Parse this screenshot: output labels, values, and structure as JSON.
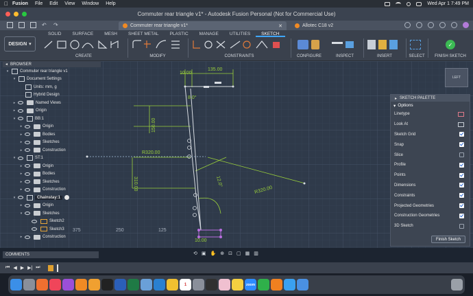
{
  "menubar": {
    "app": "Fusion",
    "items": [
      "File",
      "Edit",
      "View",
      "Window",
      "Help"
    ],
    "clock": "Wed Apr 1  7:49 PM"
  },
  "window": {
    "title": "Commuter rear triangle v1* - Autodesk Fusion Personal (Not for Commercial Use)"
  },
  "tabs": [
    {
      "label": "Commuter rear triangle v1*"
    },
    {
      "label": "Allotec C18 v2"
    }
  ],
  "toolbar": {
    "workspace": "DESIGN",
    "workspace_tabs": [
      "SOLID",
      "SURFACE",
      "MESH",
      "SHEET METAL",
      "PLASTIC",
      "MANAGE",
      "UTILITIES",
      "SKETCH"
    ],
    "groups": [
      "CREATE",
      "MODIFY",
      "CONSTRAINTS",
      "CONFIGURE",
      "INSPECT",
      "INSERT",
      "SELECT",
      "FINISH SKETCH"
    ]
  },
  "browser": {
    "title": "BROWSER",
    "rows": [
      {
        "label": "Commuter rear triangle v1",
        "indent": 0,
        "icon": "doc-icon",
        "arrow": "▾"
      },
      {
        "label": "Document Settings",
        "indent": 1,
        "icon": "gear-icon",
        "arrow": "▾"
      },
      {
        "label": "Units: mm, g",
        "indent": 2,
        "icon": "units-icon",
        "arrow": ""
      },
      {
        "label": "Hybrid Design",
        "indent": 2,
        "icon": "hybrid-icon",
        "arrow": ""
      },
      {
        "label": "Named Views",
        "indent": 1,
        "icon": "folder-icon",
        "arrow": "▸"
      },
      {
        "label": "Origin",
        "indent": 1,
        "icon": "folder-icon",
        "arrow": "▸"
      },
      {
        "label": "BB:1",
        "indent": 1,
        "icon": "component-icon",
        "arrow": "▾"
      },
      {
        "label": "Origin",
        "indent": 2,
        "icon": "folder-icon",
        "arrow": "▸"
      },
      {
        "label": "Bodies",
        "indent": 2,
        "icon": "folder-icon",
        "arrow": "▸"
      },
      {
        "label": "Sketches",
        "indent": 2,
        "icon": "folder-icon",
        "arrow": "▸"
      },
      {
        "label": "Construction",
        "indent": 2,
        "icon": "folder-icon",
        "arrow": "▸"
      },
      {
        "label": "ST:1",
        "indent": 1,
        "icon": "component-icon",
        "arrow": "▾"
      },
      {
        "label": "Origin",
        "indent": 2,
        "icon": "folder-icon",
        "arrow": "▸"
      },
      {
        "label": "Bodies",
        "indent": 2,
        "icon": "folder-icon",
        "arrow": "▸"
      },
      {
        "label": "Sketches",
        "indent": 2,
        "icon": "folder-icon",
        "arrow": "▸"
      },
      {
        "label": "Construction",
        "indent": 2,
        "icon": "folder-icon",
        "arrow": "▸"
      },
      {
        "label": "Chainstay:1",
        "indent": 1,
        "icon": "component-icon",
        "arrow": "▾",
        "active": true
      },
      {
        "label": "Origin",
        "indent": 2,
        "icon": "folder-icon",
        "arrow": "▸"
      },
      {
        "label": "Sketches",
        "indent": 2,
        "icon": "folder-icon",
        "arrow": "▾"
      },
      {
        "label": "Sketch2",
        "indent": 3,
        "icon": "sketch-icon",
        "arrow": ""
      },
      {
        "label": "Sketch3",
        "indent": 3,
        "icon": "sketch-icon",
        "arrow": ""
      },
      {
        "label": "Construction",
        "indent": 2,
        "icon": "folder-icon",
        "arrow": "▸"
      }
    ]
  },
  "palette": {
    "title": "SKETCH PALETTE",
    "section": "Options",
    "rows": [
      {
        "label": "Linetype",
        "control": "linetype-icon"
      },
      {
        "label": "Look At",
        "control": "lookat-icon"
      },
      {
        "label": "Sketch Grid",
        "checked": true
      },
      {
        "label": "Snap",
        "checked": true
      },
      {
        "label": "Slice",
        "checked": false
      },
      {
        "label": "Profile",
        "checked": true
      },
      {
        "label": "Points",
        "checked": true
      },
      {
        "label": "Dimensions",
        "checked": true
      },
      {
        "label": "Constraints",
        "checked": true
      },
      {
        "label": "Projected Geometries",
        "checked": true
      },
      {
        "label": "Construction Geometries",
        "checked": true
      },
      {
        "label": "3D Sketch",
        "checked": false
      }
    ],
    "finish_label": "Finish Sketch"
  },
  "canvas": {
    "dims": [
      "10.00",
      "135.00",
      "8.0°",
      "150.00",
      "R320.00",
      "310.00",
      "R320.00",
      "12.0°",
      "10.00"
    ],
    "ruler": [
      "375",
      "250",
      "125"
    ],
    "viewcube": "LEFT"
  },
  "comments": {
    "label": "COMMENTS"
  },
  "dock": {
    "icons": [
      "finder-icon",
      "launchpad-icon",
      "firefox-icon",
      "music-icon",
      "podcasts-icon",
      "fusion-icon",
      "books-icon",
      "appletv-icon",
      "word-icon",
      "excel-icon",
      "preview-icon",
      "onedrive-icon",
      "chrome-icon",
      "calendar-icon",
      "settings-icon",
      "terminal-icon",
      "photos-icon",
      "notes-icon",
      "zoom-icon",
      "facetime-icon",
      "vlc-icon",
      "safari-icon",
      "downloads-icon",
      "trash-icon"
    ],
    "calendar_day": "1",
    "zoom_label": "zoom"
  },
  "colors": {
    "accent": "#3fa7ff",
    "dimension": "#9bd13a",
    "sketch_line": "#d8dde3",
    "canvas_bg": "#2f3a4a"
  }
}
